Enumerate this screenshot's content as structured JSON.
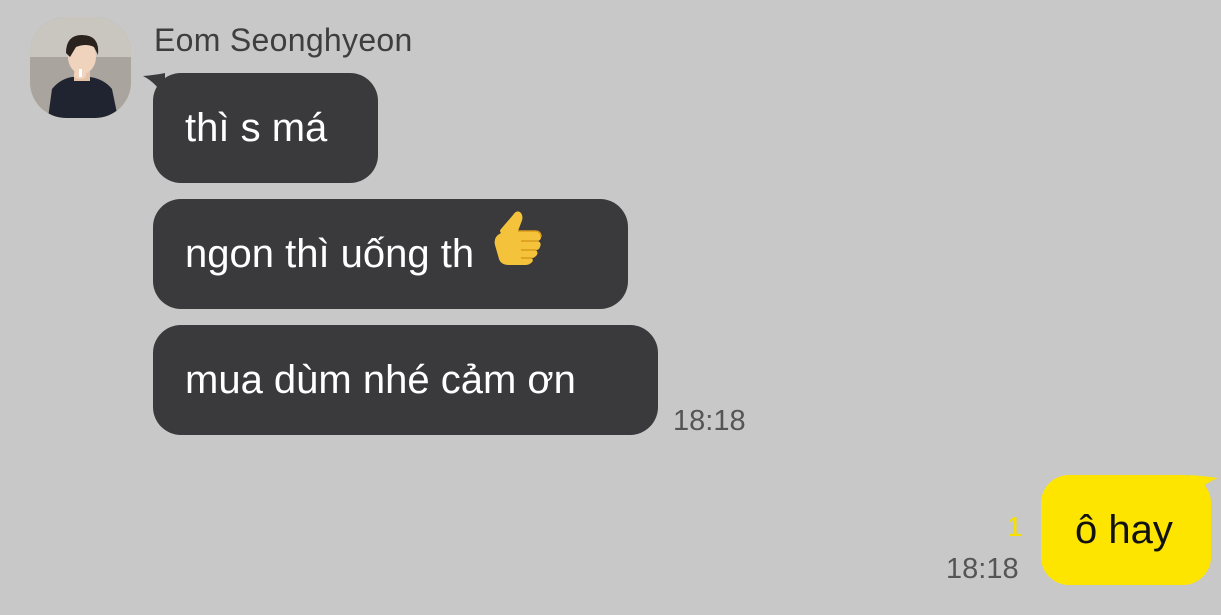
{
  "chat": {
    "sender": {
      "name": "Eom Seonghyeon",
      "avatar": "profile-photo"
    },
    "incoming": [
      {
        "text": "thì s má"
      },
      {
        "text": "ngon thì uống th",
        "emoji": "thumbs-up"
      },
      {
        "text": "mua dùm nhé cảm ơn"
      }
    ],
    "incoming_time": "18:18",
    "outgoing": {
      "text": "ô hay",
      "unread_count": "1",
      "time": "18:18"
    }
  },
  "colors": {
    "background": "#c8c8c8",
    "incoming_bubble": "#3a3a3c",
    "outgoing_bubble": "#fee500",
    "unread": "#f5e000"
  }
}
